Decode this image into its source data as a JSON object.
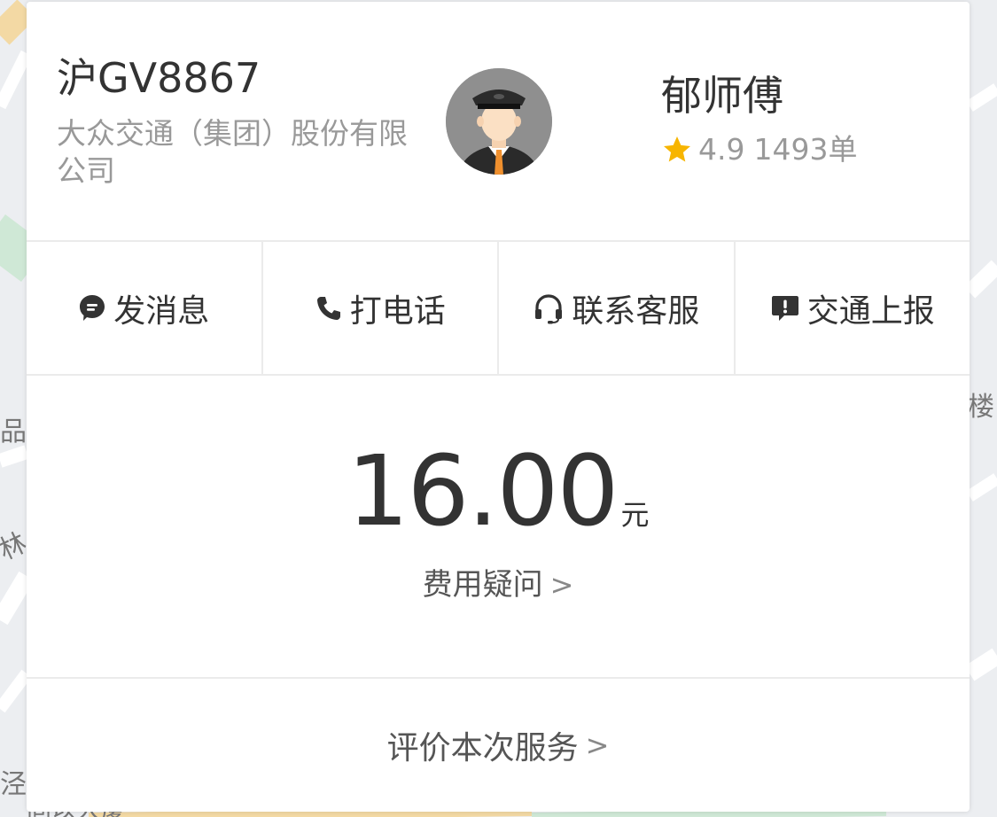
{
  "map": {
    "labels": [
      "品",
      "林",
      "泾",
      "楼",
      "同以大厦"
    ]
  },
  "driver": {
    "plate": "沪GV8867",
    "company": "大众交通（集团）股份有限公司",
    "name": "郁师傅",
    "rating": "4.9",
    "orders": "1493单",
    "star_color": "#f7b500"
  },
  "actions": [
    {
      "label": "发消息",
      "icon": "message-bubble-icon"
    },
    {
      "label": "打电话",
      "icon": "phone-icon"
    },
    {
      "label": "联系客服",
      "icon": "headset-icon"
    },
    {
      "label": "交通上报",
      "icon": "report-icon"
    }
  ],
  "fare": {
    "amount": "16.00",
    "unit": "元",
    "question": "费用疑问"
  },
  "rate_service": "评价本次服务",
  "chevron": ">"
}
